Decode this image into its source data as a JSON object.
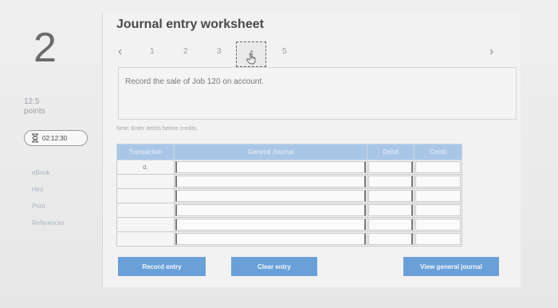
{
  "question": {
    "number": "2",
    "points": "12.5",
    "points_label": "points"
  },
  "timer": {
    "value": "02:12:30",
    "icon": "hourglass-icon"
  },
  "side_links": [
    "eBook",
    "Hint",
    "Print",
    "References"
  ],
  "worksheet": {
    "title": "Journal entry worksheet",
    "steps": [
      "1",
      "2",
      "3",
      "4",
      "5"
    ],
    "active_step": "4",
    "prev_icon": "chevron-left-icon",
    "next_icon": "chevron-right-icon",
    "prompt": "Record the sale of Job 120 on account.",
    "note": "Note: Enter debits before credits."
  },
  "journal_table": {
    "headers": [
      "Transaction",
      "General Journal",
      "Debit",
      "Credit"
    ],
    "rows": [
      {
        "transaction": "d."
      },
      {
        "transaction": ""
      },
      {
        "transaction": ""
      },
      {
        "transaction": ""
      },
      {
        "transaction": ""
      },
      {
        "transaction": ""
      }
    ]
  },
  "buttons": {
    "record": "Record entry",
    "clear": "Clear entry",
    "view": "View general journal"
  },
  "colors": {
    "header_bg": "#aac6e6",
    "button_bg": "#6aa0d8"
  }
}
